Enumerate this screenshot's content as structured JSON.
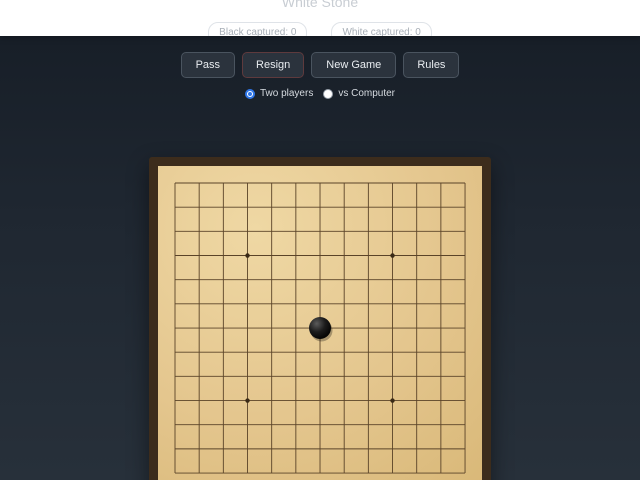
{
  "header": {
    "turn_label": "White Stone",
    "black_captured": "Black captured: 0",
    "white_captured": "White captured: 0"
  },
  "controls": {
    "pass_label": "Pass",
    "resign_label": "Resign",
    "new_game_label": "New Game",
    "rules_label": "Rules"
  },
  "modes": {
    "two_players_label": "Two players",
    "vs_computer_label": "vs Computer",
    "selected": "two_players"
  },
  "board": {
    "size": 13,
    "star_points": [
      [
        3,
        3
      ],
      [
        9,
        3
      ],
      [
        3,
        9
      ],
      [
        9,
        9
      ]
    ],
    "stones": [
      {
        "col": 6,
        "row": 6,
        "color": "black"
      }
    ]
  },
  "colors": {
    "accent": "#2f76e8",
    "board": "#e4c68e",
    "frame": "#3c2c1c",
    "grid": "#5a4328"
  }
}
